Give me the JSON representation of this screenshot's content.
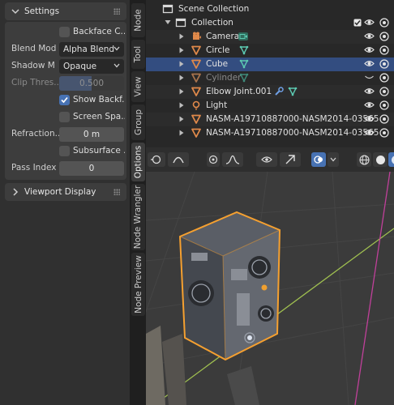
{
  "properties": {
    "settings_header": "Settings",
    "backface_culling": {
      "label": "Backface C...",
      "checked": false
    },
    "blend_mode": {
      "label": "Blend Mod",
      "value": "Alpha Blend"
    },
    "shadow_mode": {
      "label": "Shadow M",
      "value": "Opaque"
    },
    "clip_threshold": {
      "label": "Clip Thres...",
      "value": "0.500",
      "fraction": 0.5
    },
    "show_backface": {
      "label": "Show Backf...",
      "checked": true
    },
    "screen_space": {
      "label": "Screen Spa...",
      "checked": false
    },
    "refraction_depth": {
      "label": "Refraction...",
      "value": "0 m"
    },
    "subsurface": {
      "label": "Subsurface ...",
      "checked": false
    },
    "pass_index": {
      "label": "Pass Index",
      "value": "0"
    },
    "viewport_display_header": "Viewport Display"
  },
  "tabs": [
    "Node",
    "Tool",
    "View",
    "Group",
    "Options",
    "Node Wrangler",
    "Node Preview"
  ],
  "active_tab": "Options",
  "outliner": {
    "scene_collection": "Scene Collection",
    "collection": "Collection",
    "objects": [
      {
        "name": "Camera",
        "icon": "camera-icon",
        "selected": false,
        "dim": false
      },
      {
        "name": "Circle",
        "icon": "mesh-icon",
        "selected": false,
        "dim": false
      },
      {
        "name": "Cube",
        "icon": "mesh-icon",
        "selected": true,
        "dim": false
      },
      {
        "name": "Cylinder",
        "icon": "mesh-icon",
        "selected": false,
        "dim": true
      },
      {
        "name": "Elbow Joint.001",
        "icon": "mesh-icon",
        "selected": false,
        "dim": false
      },
      {
        "name": "Light",
        "icon": "light-icon",
        "selected": false,
        "dim": false
      },
      {
        "name": "NASM-A19710887000-NASM2014-03565",
        "icon": "mesh-icon",
        "selected": false,
        "dim": false
      },
      {
        "name": "NASM-A19710887000-NASM2014-03565",
        "icon": "mesh-icon",
        "selected": false,
        "dim": false
      }
    ]
  },
  "colors": {
    "accent": "#4772b3",
    "selection_outline": "#f5a030",
    "mesh_icon": "#e0894a",
    "data_icon": "#5cc9b1",
    "x_axis": "#a0c050",
    "z_axis": "#c0409a"
  }
}
